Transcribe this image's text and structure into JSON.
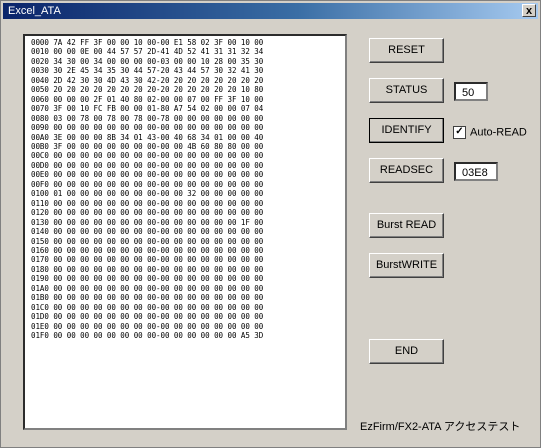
{
  "window": {
    "title": "Excel_ATA",
    "close_label": "x"
  },
  "dump": {
    "lines": [
      "0000 7A 42 FF 3F 00 00 10 00-00 E1 58 02 3F 00 10 00",
      "0010 00 00 0E 00 44 57 57 2D-41 4D 52 41 31 31 32 34",
      "0020 34 30 00 34 00 00 00 00-03 00 00 10 28 00 35 30",
      "0030 30 2E 45 34 35 30 44 57-20 43 44 57 30 32 41 30",
      "0040 2D 42 30 30 4D 43 30 42-20 20 20 20 20 20 20 20",
      "0050 20 20 20 20 20 20 20 20-20 20 20 20 20 20 10 80",
      "0060 00 00 00 2F 01 40 80 02-00 00 07 00 FF 3F 10 00",
      "0070 3F 00 10 FC FB 00 00 01-80 A7 54 02 00 00 07 04",
      "0080 03 00 78 00 78 00 78 00-78 00 00 00 00 00 00 00",
      "0090 00 00 00 00 00 00 00 00-00 00 00 00 00 00 00 00",
      "00A0 3E 00 00 00 8B 34 01 43-00 40 68 34 01 00 00 40",
      "00B0 3F 00 00 00 00 00 00 00-00 00 4B 60 80 80 00 00",
      "00C0 00 00 00 00 00 00 00 00-00 00 00 00 00 00 00 00",
      "00D0 00 00 00 00 00 00 00 00-00 00 00 00 00 00 00 00",
      "00E0 00 00 00 00 00 00 00 00-00 00 00 00 00 00 00 00",
      "00F0 00 00 00 00 00 00 00 00-00 00 00 00 00 00 00 00",
      "0100 01 00 00 00 00 00 00 00-00 00 32 00 00 00 00 00",
      "0110 00 00 00 00 00 00 00 00-00 00 00 00 00 00 00 00",
      "0120 00 00 00 00 00 00 00 00-00 00 00 00 00 00 00 00",
      "0130 00 00 00 00 00 00 00 00-00 00 00 00 00 00 1F 00",
      "0140 00 00 00 00 00 00 00 00-00 00 00 00 00 00 00 00",
      "0150 00 00 00 00 00 00 00 00-00 00 00 00 00 00 00 00",
      "0160 00 00 00 00 00 00 00 00-00 00 00 00 00 00 00 00",
      "0170 00 00 00 00 00 00 00 00-00 00 00 00 00 00 00 00",
      "0180 00 00 00 00 00 00 00 00-00 00 00 00 00 00 00 00",
      "0190 00 00 00 00 00 00 00 00-00 00 00 00 00 00 00 00",
      "01A0 00 00 00 00 00 00 00 00-00 00 00 00 00 00 00 00",
      "01B0 00 00 00 00 00 00 00 00-00 00 00 00 00 00 00 00",
      "01C0 00 00 00 00 00 00 00 00-00 00 00 00 00 00 00 00",
      "01D0 00 00 00 00 00 00 00 00-00 00 00 00 00 00 00 00",
      "01E0 00 00 00 00 00 00 00 00-00 00 00 00 00 00 00 00",
      "01F0 00 00 00 00 00 00 00 00-00 00 00 00 00 00 A5 3D"
    ]
  },
  "buttons": {
    "reset": "RESET",
    "status": "STATUS",
    "identify": "IDENTIFY",
    "readsec": "READSEC",
    "burst_read": "Burst READ",
    "burst_write": "BurstWRITE",
    "end": "END"
  },
  "fields": {
    "status_value": "50",
    "sector_value": "03E8"
  },
  "checkbox": {
    "label": "Auto-READ",
    "checked": true,
    "mark": "✓"
  },
  "footer": {
    "text": "EzFirm/FX2-ATA アクセステスト"
  }
}
